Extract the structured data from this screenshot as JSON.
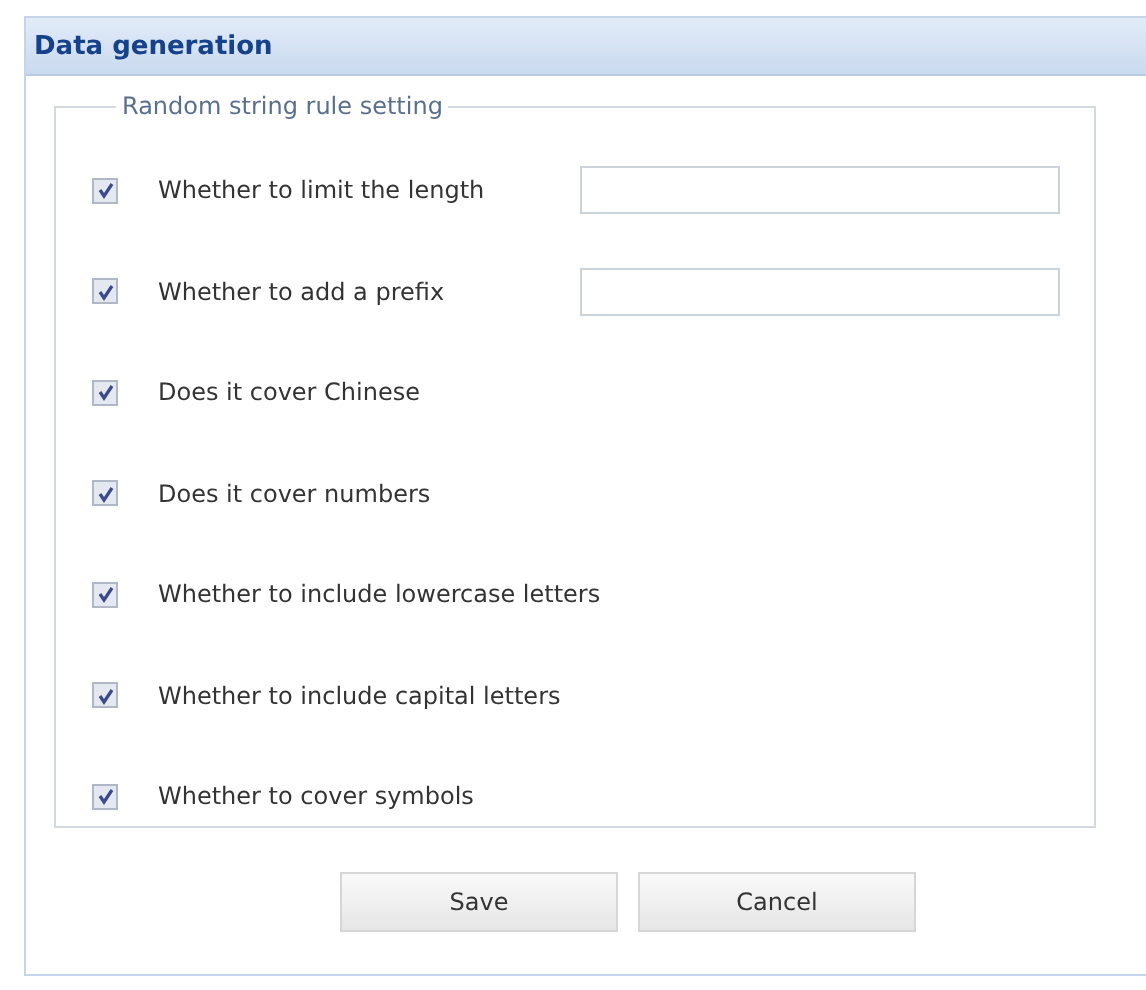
{
  "window": {
    "title": "Data generation"
  },
  "fieldset": {
    "legend": "Random string rule setting",
    "options": [
      {
        "label": "Whether to limit the length",
        "checked": true,
        "kind": "field"
      },
      {
        "label": "Whether to add a prefix",
        "checked": true,
        "kind": "field"
      },
      {
        "label": "Does it cover Chinese",
        "checked": true,
        "kind": "check"
      },
      {
        "label": "Does it cover numbers",
        "checked": true,
        "kind": "check"
      },
      {
        "label": "Whether to include lowercase letters",
        "checked": true,
        "kind": "check"
      },
      {
        "label": "Whether to include capital letters",
        "checked": true,
        "kind": "check"
      },
      {
        "label": "Whether to cover symbols",
        "checked": true,
        "kind": "check"
      }
    ]
  },
  "buttons": [
    "Save",
    "Cancel"
  ]
}
